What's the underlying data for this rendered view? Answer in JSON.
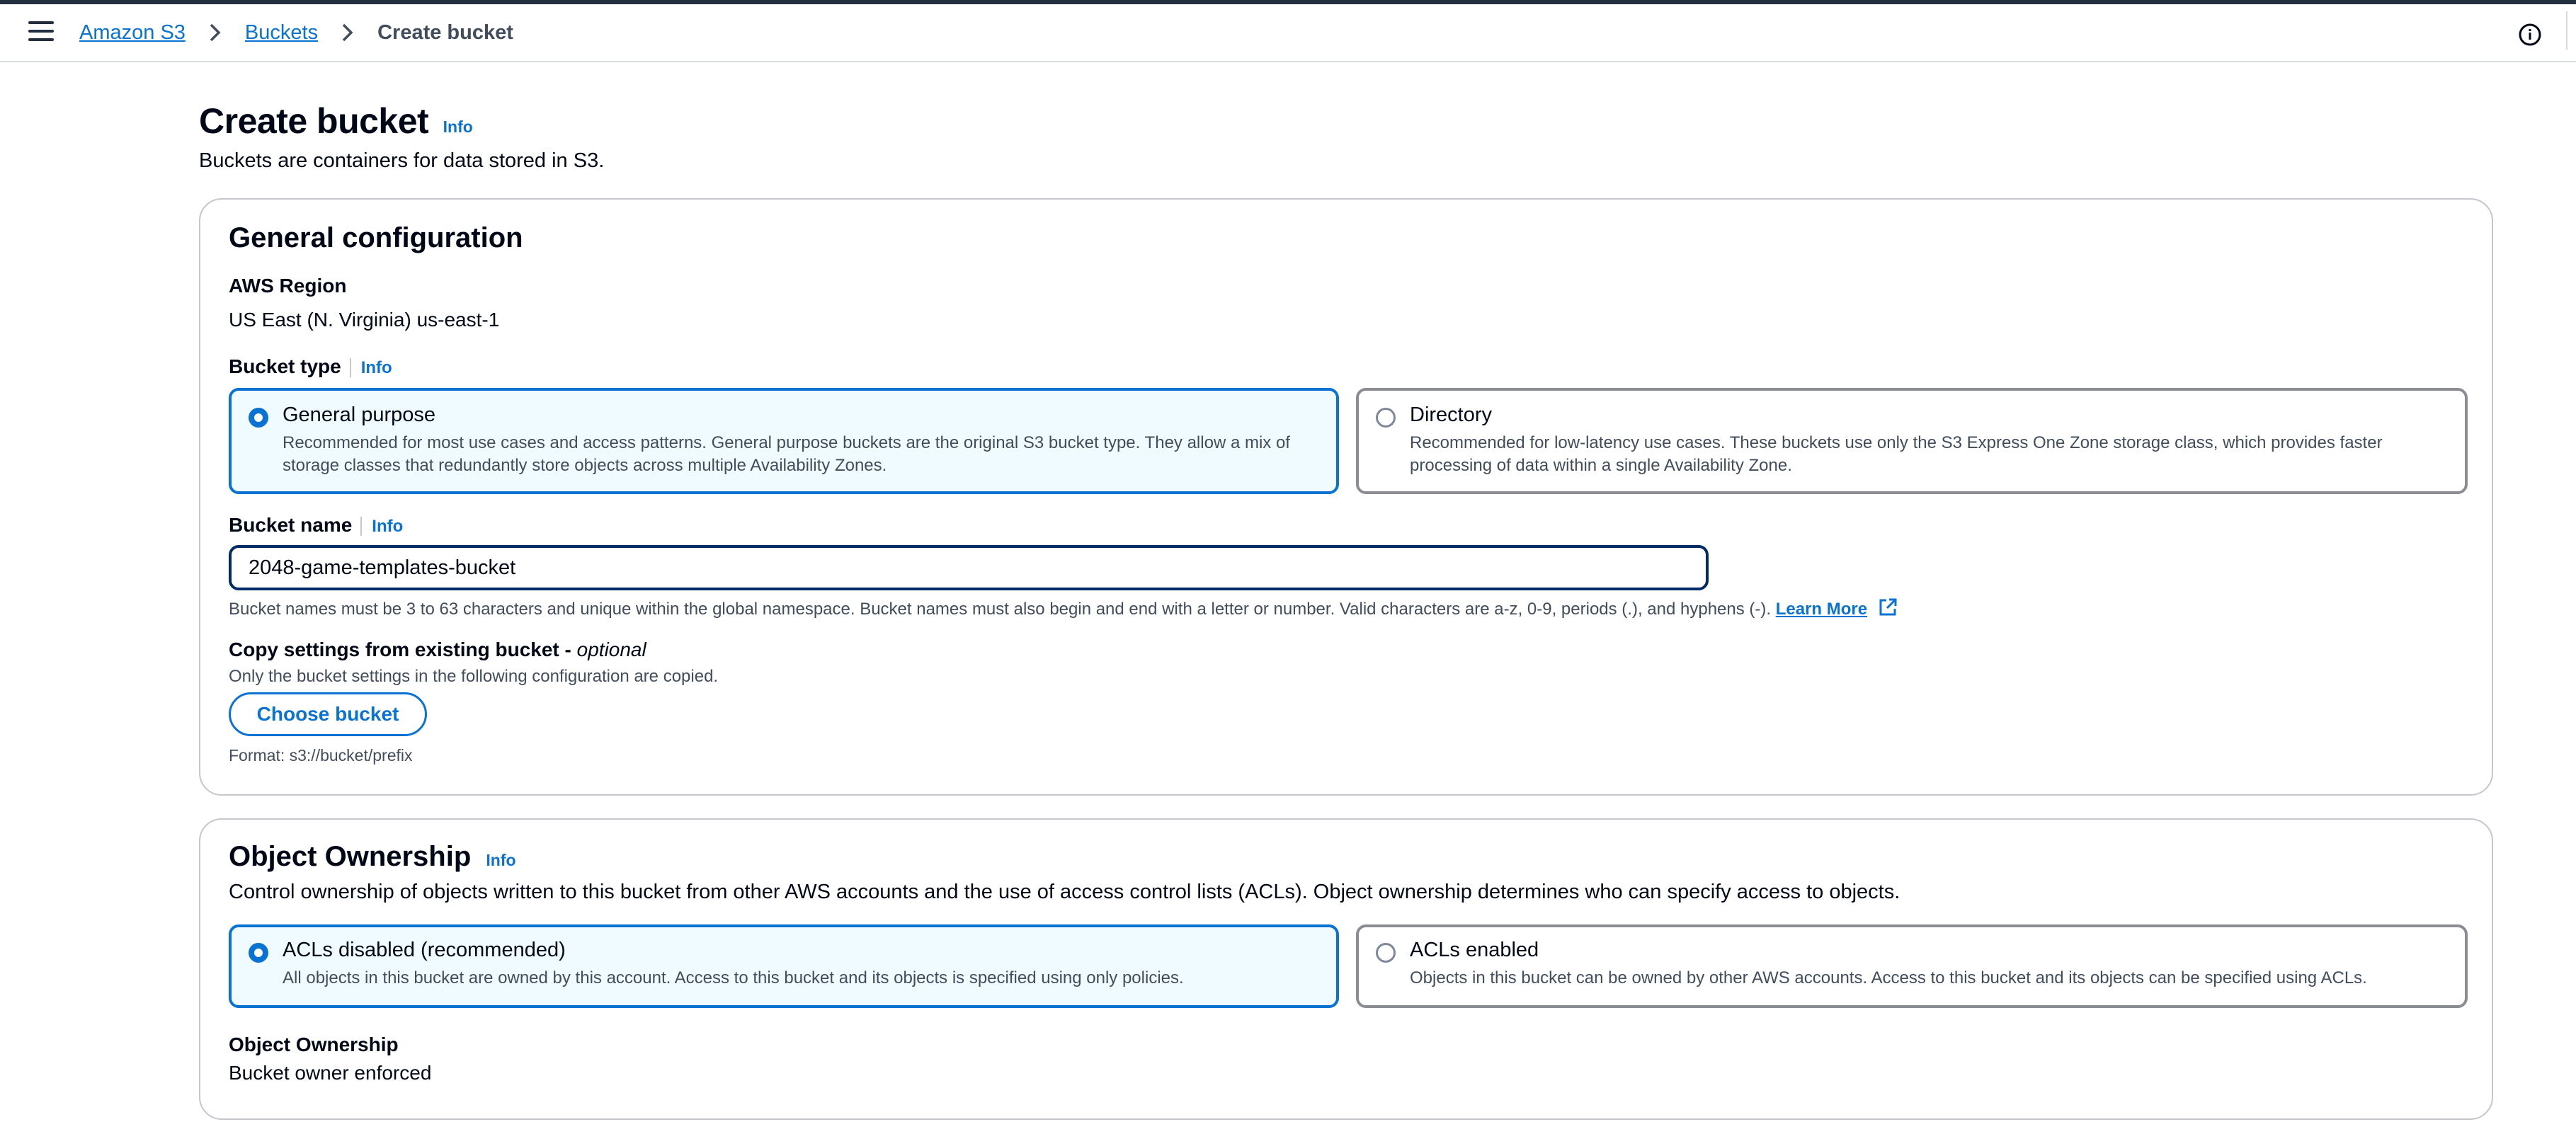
{
  "header": {
    "breadcrumb": [
      {
        "label": "Amazon S3"
      },
      {
        "label": "Buckets"
      },
      {
        "label": "Create bucket"
      }
    ]
  },
  "page": {
    "title": "Create bucket",
    "info": "Info",
    "description": "Buckets are containers for data stored in S3."
  },
  "general": {
    "title": "General configuration",
    "region_label": "AWS Region",
    "region_value": "US East (N. Virginia) us-east-1",
    "bucket_type_label": "Bucket type",
    "info": "Info",
    "options": [
      {
        "title": "General purpose",
        "description": "Recommended for most use cases and access patterns. General purpose buckets are the original S3 bucket type. They allow a mix of storage classes that redundantly store objects across multiple Availability Zones.",
        "selected": true
      },
      {
        "title": "Directory",
        "description": "Recommended for low-latency use cases. These buckets use only the S3 Express One Zone storage class, which provides faster processing of data within a single Availability Zone.",
        "selected": false
      }
    ],
    "bucket_name_label": "Bucket name",
    "bucket_name_value": "2048-game-templates-bucket",
    "bucket_name_hint": "Bucket names must be 3 to 63 characters and unique within the global namespace. Bucket names must also begin and end with a letter or number. Valid characters are a-z, 0-9, periods (.), and hyphens (-).",
    "learn_more": "Learn More",
    "copy_label": "Copy settings from existing bucket - ",
    "copy_optional": "optional",
    "copy_desc": "Only the bucket settings in the following configuration are copied.",
    "choose_button": "Choose bucket",
    "format_hint": "Format: s3://bucket/prefix"
  },
  "ownership": {
    "title": "Object Ownership",
    "info": "Info",
    "description": "Control ownership of objects written to this bucket from other AWS accounts and the use of access control lists (ACLs). Object ownership determines who can specify access to objects.",
    "options": [
      {
        "title": "ACLs disabled (recommended)",
        "description": "All objects in this bucket are owned by this account. Access to this bucket and its objects is specified using only policies.",
        "selected": true
      },
      {
        "title": "ACLs enabled",
        "description": "Objects in this bucket can be owned by other AWS accounts. Access to this bucket and its objects can be specified using ACLs.",
        "selected": false
      }
    ],
    "result_label": "Object Ownership",
    "result_value": "Bucket owner enforced"
  },
  "colors": {
    "accent": "#0972d3",
    "selected_bg": "#f0fbff",
    "text": "#000716",
    "secondary_text": "#414d5c"
  },
  "icons": [
    "menu-icon",
    "chevron-right-icon",
    "info-circle-icon",
    "external-link-icon"
  ]
}
